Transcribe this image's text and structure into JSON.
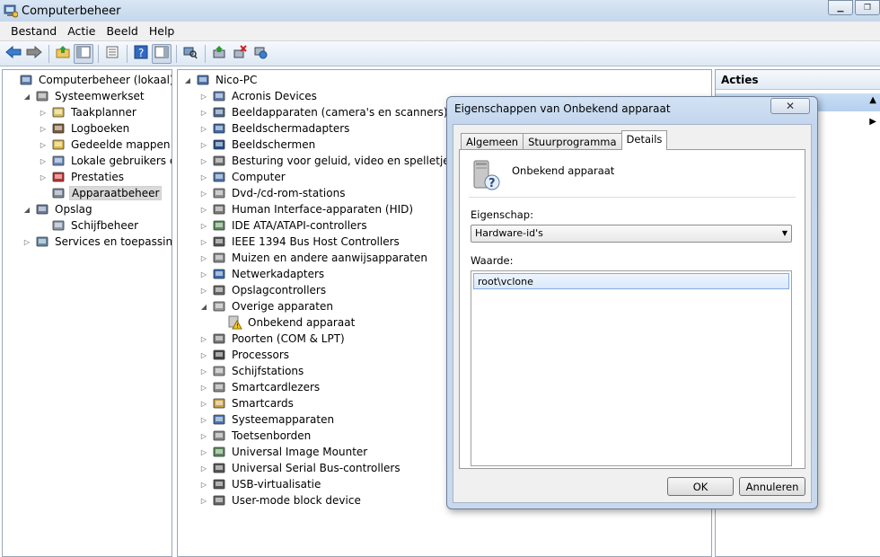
{
  "window": {
    "title": "Computerbeheer"
  },
  "menu": [
    "Bestand",
    "Actie",
    "Beeld",
    "Help"
  ],
  "left_tree": [
    {
      "label": "Computerbeheer (lokaal)",
      "depth": 0,
      "exp": "",
      "icon": "computer-management-icon",
      "selected": false
    },
    {
      "label": "Systeemwerkset",
      "depth": 1,
      "exp": "◢",
      "icon": "tools-icon",
      "selected": false
    },
    {
      "label": "Taakplanner",
      "depth": 2,
      "exp": "▷",
      "icon": "clock-icon",
      "selected": false
    },
    {
      "label": "Logboeken",
      "depth": 2,
      "exp": "▷",
      "icon": "event-log-icon",
      "selected": false
    },
    {
      "label": "Gedeelde mappen",
      "depth": 2,
      "exp": "▷",
      "icon": "shared-folder-icon",
      "selected": false
    },
    {
      "label": "Lokale gebruikers en gr",
      "depth": 2,
      "exp": "▷",
      "icon": "users-icon",
      "selected": false
    },
    {
      "label": "Prestaties",
      "depth": 2,
      "exp": "▷",
      "icon": "performance-icon",
      "selected": false
    },
    {
      "label": "Apparaatbeheer",
      "depth": 2,
      "exp": "",
      "icon": "device-manager-icon",
      "selected": true
    },
    {
      "label": "Opslag",
      "depth": 1,
      "exp": "◢",
      "icon": "storage-icon",
      "selected": false
    },
    {
      "label": "Schijfbeheer",
      "depth": 2,
      "exp": "",
      "icon": "disk-management-icon",
      "selected": false
    },
    {
      "label": "Services en toepassingen",
      "depth": 1,
      "exp": "▷",
      "icon": "services-icon",
      "selected": false
    }
  ],
  "device_tree": [
    {
      "label": "Nico-PC",
      "depth": 0,
      "exp": "◢",
      "icon": "computer-icon"
    },
    {
      "label": "Acronis Devices",
      "depth": 1,
      "exp": "▷",
      "icon": "device-icon"
    },
    {
      "label": "Beeldapparaten (camera's en scanners)",
      "depth": 1,
      "exp": "▷",
      "icon": "camera-icon"
    },
    {
      "label": "Beeldschermadapters",
      "depth": 1,
      "exp": "▷",
      "icon": "display-adapter-icon"
    },
    {
      "label": "Beeldschermen",
      "depth": 1,
      "exp": "▷",
      "icon": "monitor-icon"
    },
    {
      "label": "Besturing voor geluid, video en spelletjes",
      "depth": 1,
      "exp": "▷",
      "icon": "speaker-icon"
    },
    {
      "label": "Computer",
      "depth": 1,
      "exp": "▷",
      "icon": "computer-icon"
    },
    {
      "label": "Dvd-/cd-rom-stations",
      "depth": 1,
      "exp": "▷",
      "icon": "dvd-drive-icon"
    },
    {
      "label": "Human Interface-apparaten (HID)",
      "depth": 1,
      "exp": "▷",
      "icon": "hid-icon"
    },
    {
      "label": "IDE ATA/ATAPI-controllers",
      "depth": 1,
      "exp": "▷",
      "icon": "ide-controller-icon"
    },
    {
      "label": "IEEE 1394 Bus Host Controllers",
      "depth": 1,
      "exp": "▷",
      "icon": "firewire-icon"
    },
    {
      "label": "Muizen en andere aanwijsapparaten",
      "depth": 1,
      "exp": "▷",
      "icon": "mouse-icon"
    },
    {
      "label": "Netwerkadapters",
      "depth": 1,
      "exp": "▷",
      "icon": "network-icon"
    },
    {
      "label": "Opslagcontrollers",
      "depth": 1,
      "exp": "▷",
      "icon": "storage-controller-icon"
    },
    {
      "label": "Overige apparaten",
      "depth": 1,
      "exp": "◢",
      "icon": "unknown-device-icon"
    },
    {
      "label": "Onbekend apparaat",
      "depth": 2,
      "exp": "",
      "icon": "warning-device-icon"
    },
    {
      "label": "Poorten (COM & LPT)",
      "depth": 1,
      "exp": "▷",
      "icon": "port-icon"
    },
    {
      "label": "Processors",
      "depth": 1,
      "exp": "▷",
      "icon": "processor-icon"
    },
    {
      "label": "Schijfstations",
      "depth": 1,
      "exp": "▷",
      "icon": "disk-drive-icon"
    },
    {
      "label": "Smartcardlezers",
      "depth": 1,
      "exp": "▷",
      "icon": "smartcard-reader-icon"
    },
    {
      "label": "Smartcards",
      "depth": 1,
      "exp": "▷",
      "icon": "smartcard-icon"
    },
    {
      "label": "Systeemapparaten",
      "depth": 1,
      "exp": "▷",
      "icon": "system-device-icon"
    },
    {
      "label": "Toetsenborden",
      "depth": 1,
      "exp": "▷",
      "icon": "keyboard-icon"
    },
    {
      "label": "Universal Image Mounter",
      "depth": 1,
      "exp": "▷",
      "icon": "image-mounter-icon"
    },
    {
      "label": "Universal Serial Bus-controllers",
      "depth": 1,
      "exp": "▷",
      "icon": "usb-icon"
    },
    {
      "label": "USB-virtualisatie",
      "depth": 1,
      "exp": "▷",
      "icon": "usb-icon"
    },
    {
      "label": "User-mode block device",
      "depth": 1,
      "exp": "▷",
      "icon": "block-device-icon"
    }
  ],
  "actions_pane": {
    "header": "Acties"
  },
  "dialog": {
    "title": "Eigenschappen van Onbekend apparaat",
    "close": "✕",
    "tabs": [
      "Algemeen",
      "Stuurprogramma",
      "Details"
    ],
    "active_tab": 2,
    "device_name": "Onbekend apparaat",
    "property_label": "Eigenschap:",
    "property_value": "Hardware-id's",
    "value_label": "Waarde:",
    "values": [
      "root\\vclone"
    ],
    "ok": "OK",
    "cancel": "Annuleren"
  }
}
